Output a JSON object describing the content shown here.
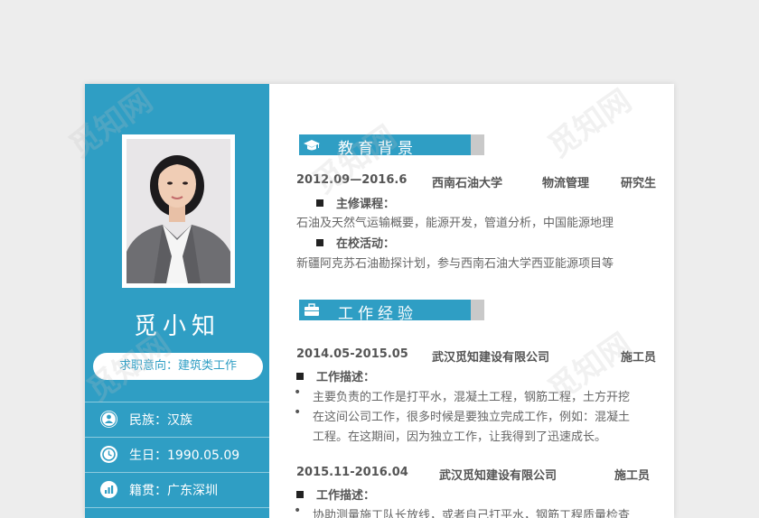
{
  "sidebar": {
    "name": "觅小知",
    "intention_label": "求职意向：",
    "intention_value": "建筑类工作",
    "info": [
      {
        "icon": "person-icon",
        "label": "民族：",
        "value": "汉族"
      },
      {
        "icon": "clock-icon",
        "label": "生日：",
        "value": "1990.05.09"
      },
      {
        "icon": "bar-chart-icon",
        "label": "籍贯：",
        "value": "广东深圳"
      }
    ]
  },
  "education": {
    "title": "教育背景",
    "period": "2012.09—2016.6",
    "school": "西南石油大学",
    "major": "物流管理",
    "degree": "研究生",
    "courses_label": "主修课程：",
    "courses": "石油及天然气运输概要，能源开发，管道分析，中国能源地理",
    "activities_label": "在校活动：",
    "activities": "新疆阿克苏石油勘探计划，参与西南石油大学西亚能源项目等"
  },
  "work": {
    "title": "工作经验",
    "jobs": [
      {
        "period": "2014.05-2015.05",
        "company": "武汉觅知建设有限公司",
        "role": "施工员",
        "desc_label": "工作描述：",
        "bullets": [
          "主要负责的工作是打平水，混凝土工程，钢筋工程，土方开挖",
          "在这间公司工作，很多时候是要独立完成工作，例如：混凝土",
          "工程。在这期间，因为独立工作，让我得到了迅速成长。"
        ]
      },
      {
        "period": "2015.11-2016.04",
        "company": "武汉觅知建设有限公司",
        "role": "施工员",
        "desc_label": "工作描述：",
        "bullets": [
          "协助测量施工队长放线，或者自己打平水，钢筋工程质量检查"
        ]
      }
    ]
  },
  "watermark": "觅知网",
  "colors": {
    "accent": "#2f9ec4",
    "tail": "#c9c9c9"
  }
}
